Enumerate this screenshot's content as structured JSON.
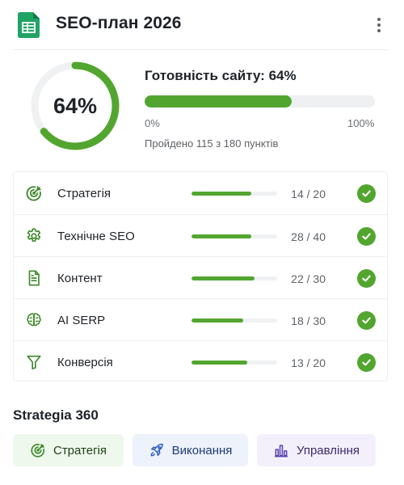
{
  "app": {
    "title": "SEO-план 2026",
    "icon": "spreadsheet-icon",
    "menu_icon": "kebab-menu-icon"
  },
  "overview": {
    "percent_value": 64,
    "percent_label": "64%",
    "readiness_title": "Готовність сайту: 64%",
    "scale_min": "0%",
    "scale_max": "100%",
    "passed_text": "Пройдено 115 з 180 пунктів"
  },
  "checklist": [
    {
      "label": "Стратегія",
      "count": "14 / 20",
      "done": 14,
      "total": 20,
      "icon": "target-icon",
      "checked": true
    },
    {
      "label": "Технічне SEO",
      "count": "28 / 40",
      "done": 28,
      "total": 40,
      "icon": "gear-icon",
      "checked": true
    },
    {
      "label": "Контент",
      "count": "22 / 30",
      "done": 22,
      "total": 30,
      "icon": "document-icon",
      "checked": true
    },
    {
      "label": "AI SERP",
      "count": "18 / 30",
      "done": 18,
      "total": 30,
      "icon": "brain-icon",
      "checked": true
    },
    {
      "label": "Конверсія",
      "count": "13 / 20",
      "done": 13,
      "total": 20,
      "icon": "funnel-icon",
      "checked": true
    }
  ],
  "footer": {
    "title": "Strategia 360",
    "buttons": [
      {
        "label": "Стратегія",
        "icon": "target-icon"
      },
      {
        "label": "Виконання",
        "icon": "rocket-icon"
      },
      {
        "label": "Управління",
        "icon": "bar-chart-icon"
      }
    ]
  },
  "colors": {
    "accent_green": "#52a62f",
    "track_gray": "#eef0f2",
    "text_dark": "#1f2328"
  }
}
